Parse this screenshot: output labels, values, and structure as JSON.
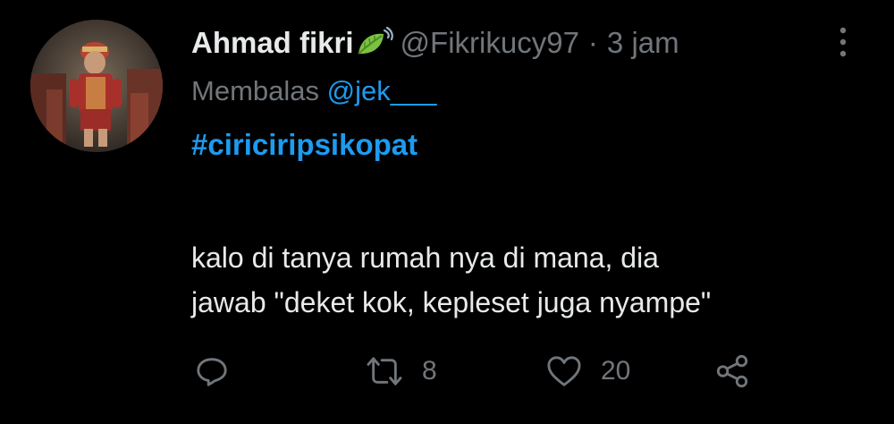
{
  "tweet": {
    "display_name": "Ahmad fikri",
    "handle": "@Fikrikucy97",
    "separator": "·",
    "time": "3 jam",
    "reply_prefix": "Membalas",
    "reply_to": "@jek___",
    "hashtag": "#ciriciripsikopat",
    "text_lines": [
      "kalo di tanya rumah nya di mana, dia",
      "jawab \"deket kok, kepleset juga nyampe\""
    ],
    "retweet_count": "8",
    "like_count": "20"
  },
  "icons": {
    "name_emoji": "leaf-fluttering-in-wind",
    "more": "vertical-ellipsis",
    "reply": "speech-bubble",
    "retweet": "retweet-arrows",
    "like": "heart",
    "share": "share-nodes"
  },
  "colors": {
    "background": "#000000",
    "primary_text": "#e7e9ea",
    "secondary_text": "#71767b",
    "link": "#1d9bf0"
  }
}
